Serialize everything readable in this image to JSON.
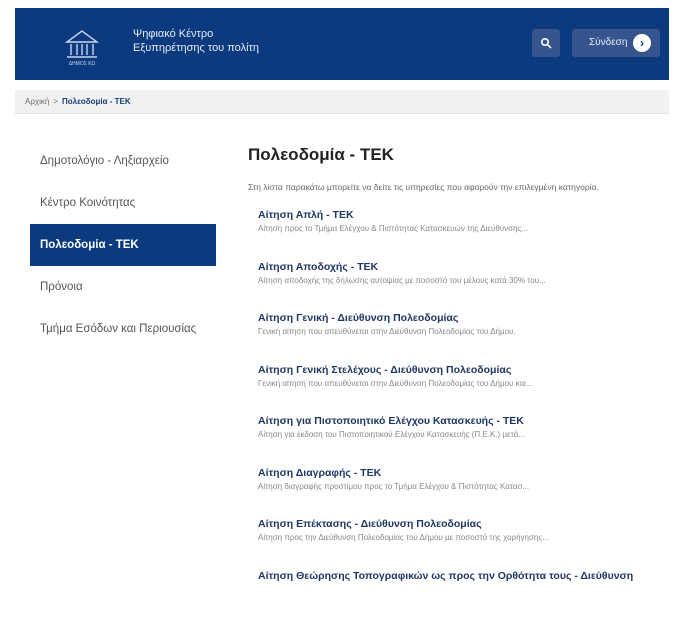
{
  "header": {
    "logo_text": "ΔΗΜΟΣ ΚΩ",
    "brand_line1": "Ψηφιακό Κέντρο",
    "brand_line2": "Εξυπηρέτησης του πολίτη",
    "search_icon": "search-icon",
    "login_label": "Σύνδεση",
    "login_icon": "arrow-right-circle-icon"
  },
  "breadcrumb": {
    "home": "Αρχική",
    "separator": ">",
    "current": "Πολεοδομία - ΤΕΚ"
  },
  "sidebar": {
    "items": [
      {
        "label": "Δημοτολόγιο - Ληξιαρχείο",
        "active": false
      },
      {
        "label": "Κέντρο Κοινότητας",
        "active": false
      },
      {
        "label": "Πολεοδομία - ΤΕΚ",
        "active": true
      },
      {
        "label": "Πρόνοια",
        "active": false
      },
      {
        "label": "Τμήμα Εσόδων και Περιουσίας",
        "active": false
      }
    ]
  },
  "main": {
    "title": "Πολεοδομία - ΤΕΚ",
    "intro": "Στη λίστα παρακάτω μπορείτε να δείτε τις υπηρεσίες που αφορούν την επιλεγμένη κατηγορία.",
    "services": [
      {
        "title": "Αίτηση Απλή - ΤΕΚ",
        "desc": "Αίτηση προς το Τμήμα Ελέγχου & Πιστότητας Κατασκευών της Διεύθυνσης..."
      },
      {
        "title": "Αίτηση Αποδοχής - ΤΕΚ",
        "desc": "Αίτηση αποδοχής της δήλωσης αυτοψίας με ποσοστό του μέλους κατά 30% του..."
      },
      {
        "title": "Αίτηση Γενική - Διεύθυνση Πολεοδομίας",
        "desc": "Γενική αίτηση που απευθύνεται στην Διεύθυνση Πολεοδομίας του Δήμου."
      },
      {
        "title": "Αίτηση Γενική Στελέχους - Διεύθυνση Πολεοδομίας",
        "desc": "Γενική αίτηση που απευθύνεται στην Διεύθυνση Πολεοδομίας του Δήμου και..."
      },
      {
        "title": "Αίτηση για Πιστοποιητικό Ελέγχου Κατασκευής - ΤΕΚ",
        "desc": "Αίτηση για έκδοση του Πιστοποιητικού Ελέγχου Κατασκευής (Π.Ε.Κ.) μετά..."
      },
      {
        "title": "Αίτηση Διαγραφής - ΤΕΚ",
        "desc": "Αίτηση διαγραφής προστίμου προς το Τμήμα Ελέγχου & Πιστότητας Κατασ..."
      },
      {
        "title": "Αίτηση Επέκτασης - Διεύθυνση Πολεοδομίας",
        "desc": "Αίτηση προς την Διεύθυνση Πολεοδομίας του Δήμου με ποσοστό της χορήγησης..."
      },
      {
        "title": "Αίτηση Θεώρησης Τοπογραφικών ως προς την Ορθότητα τους - Διεύθυνση",
        "desc": ""
      }
    ]
  }
}
